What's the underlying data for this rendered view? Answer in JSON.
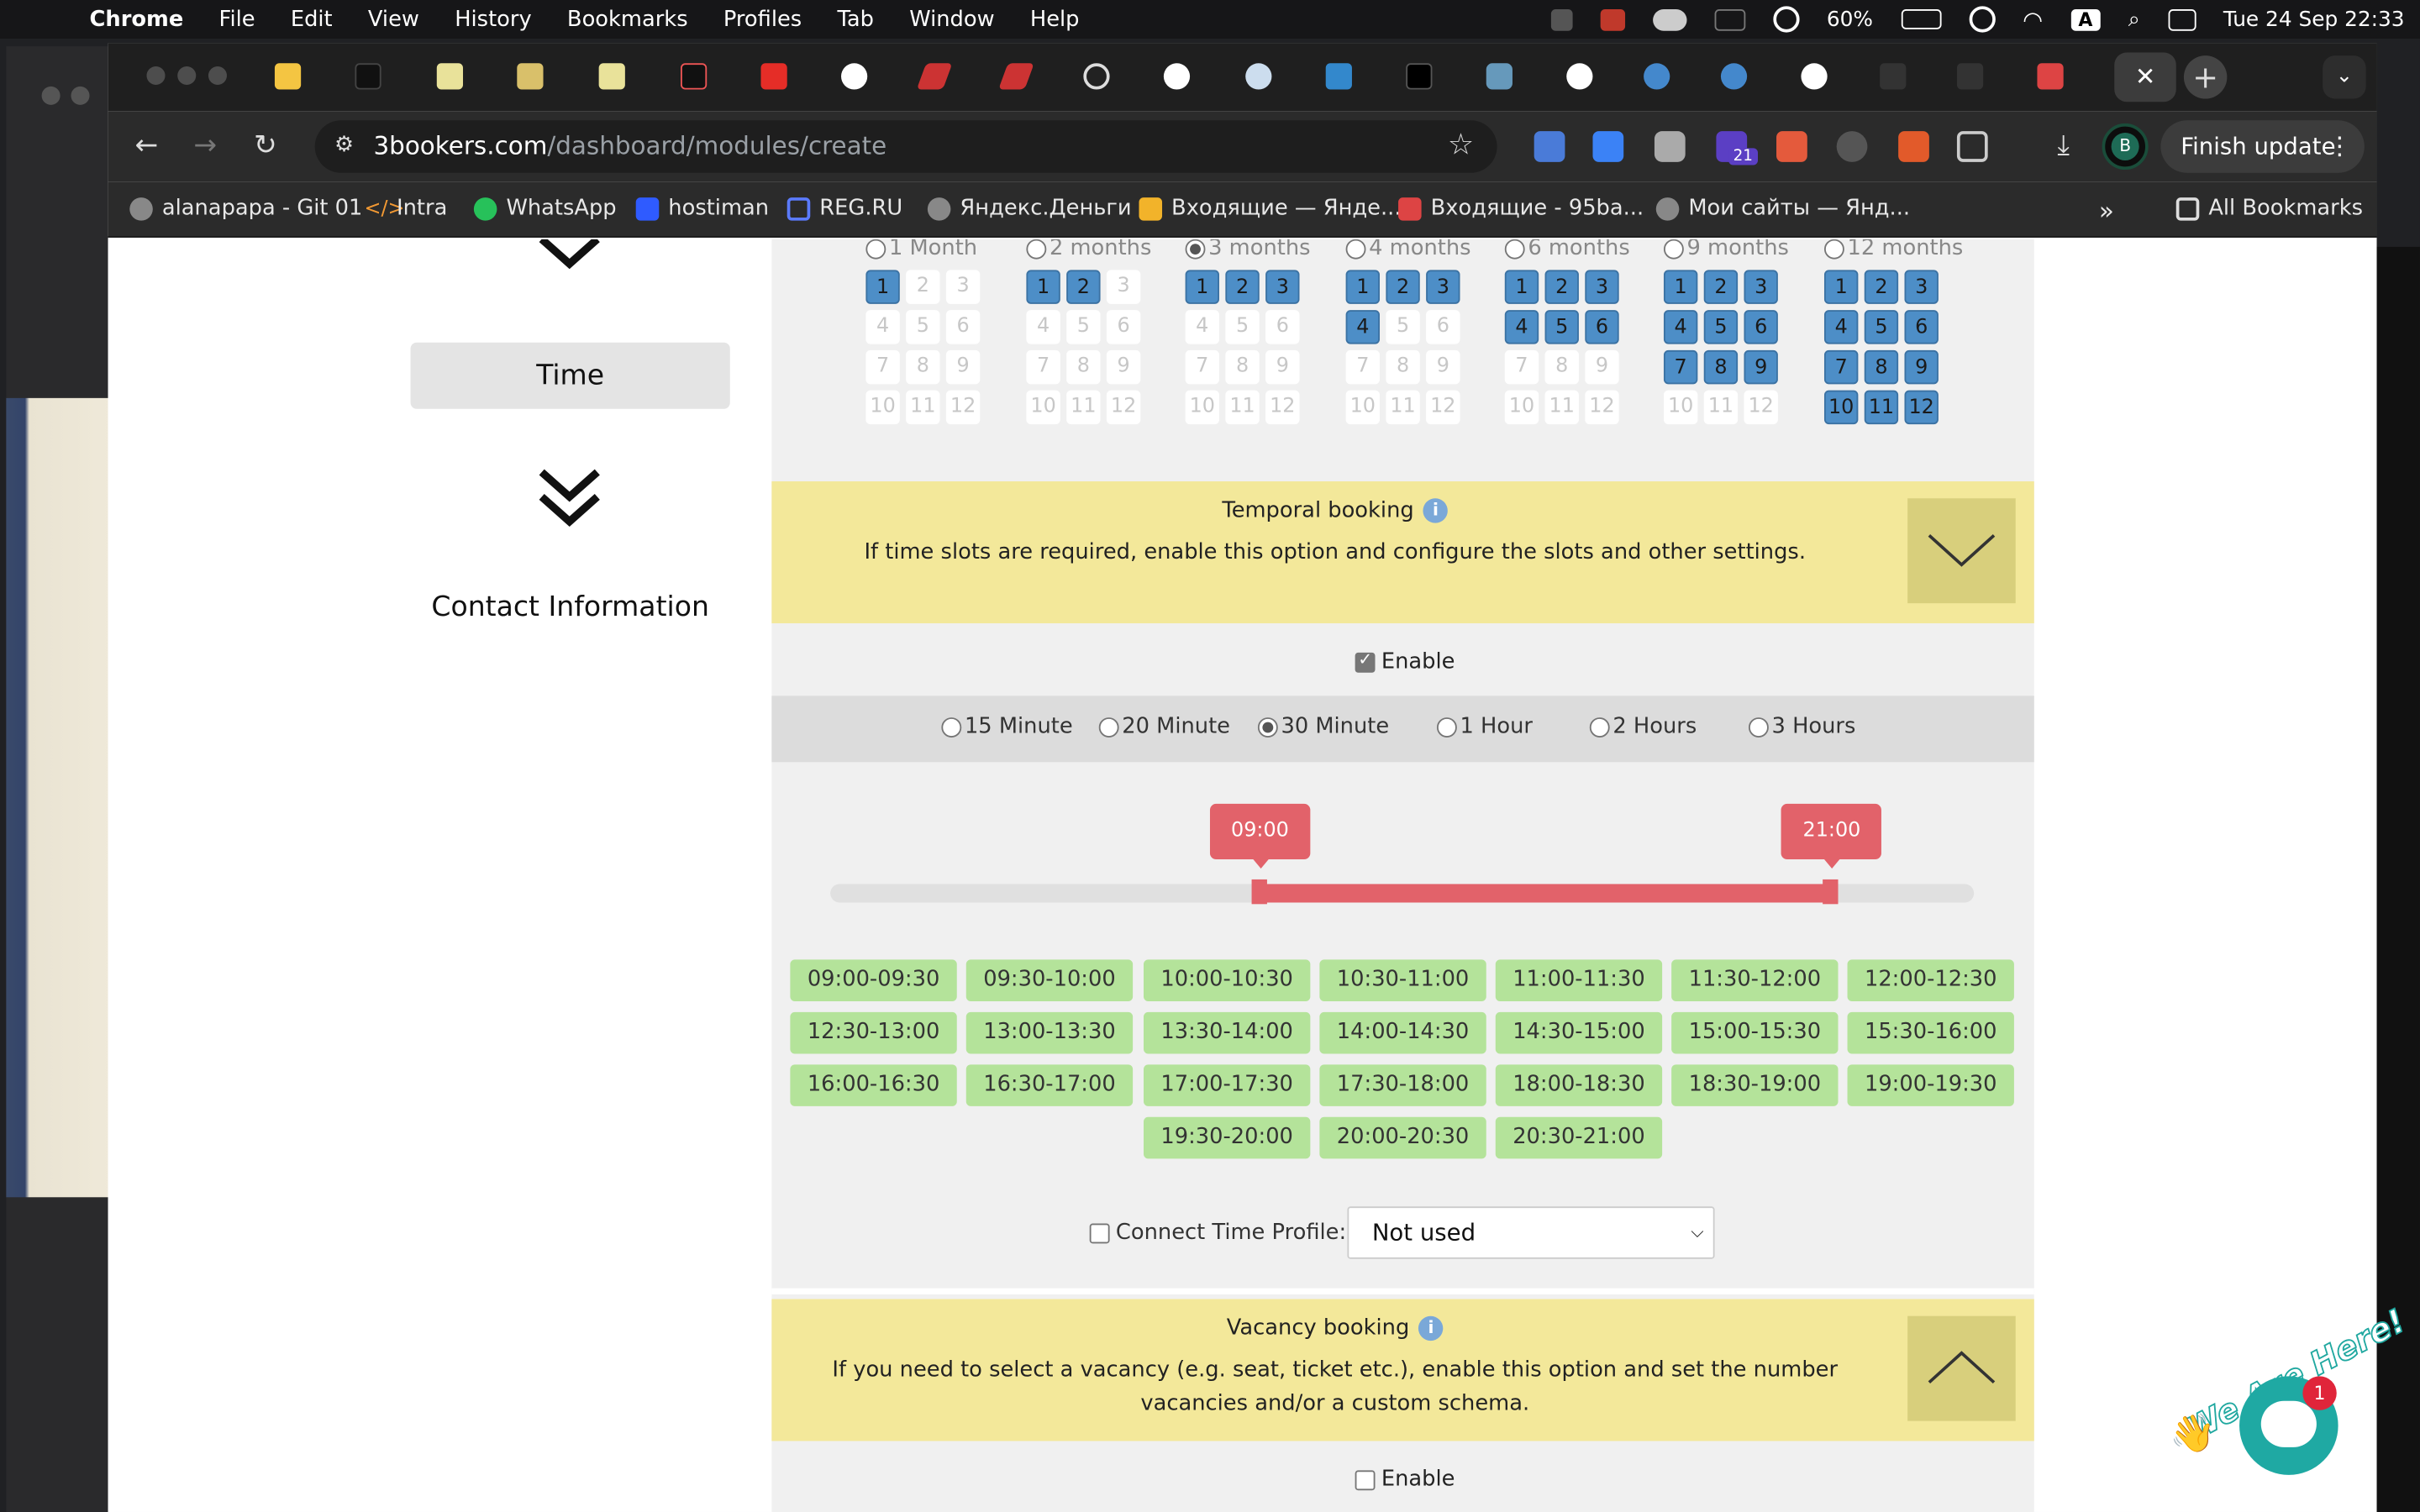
{
  "menubar": {
    "app": "Chrome",
    "items": [
      "File",
      "Edit",
      "View",
      "History",
      "Bookmarks",
      "Profiles",
      "Tab",
      "Window",
      "Help"
    ],
    "battery": "60%",
    "input_source": "A",
    "datetime": "Tue 24 Sep  22:33"
  },
  "browser": {
    "close_tab": "✕",
    "new_tab": "+",
    "url_host": "3bookers.com",
    "url_path": "/dashboard/modules/create",
    "ext_badge": "21",
    "avatar_letter": "B",
    "finish_update": "Finish update",
    "bookmarks": [
      "alanapapa - Git 01",
      "Intra",
      "WhatsApp",
      "hostiman",
      "REG.RU",
      "Яндекс.Деньги",
      "Входящие — Янде...",
      "Входящие - 95ba...",
      "Мои сайты — Янд..."
    ],
    "all_bookmarks": "All Bookmarks",
    "bookmarks_overflow": "»"
  },
  "sidebar": {
    "time_button": "Time",
    "contact_info": "Contact Information"
  },
  "months": [
    {
      "label": "1 Month",
      "selected": false,
      "active": [
        1
      ]
    },
    {
      "label": "2 months",
      "selected": false,
      "active": [
        1,
        2
      ]
    },
    {
      "label": "3 months",
      "selected": true,
      "active": [
        1,
        2,
        3
      ]
    },
    {
      "label": "4 months",
      "selected": false,
      "active": [
        1,
        2,
        3,
        4
      ]
    },
    {
      "label": "6 months",
      "selected": false,
      "active": [
        1,
        2,
        3,
        4,
        5,
        6
      ]
    },
    {
      "label": "9 months",
      "selected": false,
      "active": [
        1,
        2,
        3,
        4,
        5,
        6,
        7,
        8,
        9
      ]
    },
    {
      "label": "12 months",
      "selected": false,
      "active": [
        1,
        2,
        3,
        4,
        5,
        6,
        7,
        8,
        9,
        10,
        11,
        12
      ]
    }
  ],
  "temporal": {
    "title": "Temporal booking",
    "info_icon": "i",
    "desc": "If time slots are required, enable this option and configure the slots and other settings.",
    "enable_label": "Enable",
    "enabled": true
  },
  "durations": [
    {
      "label": "15 Minute",
      "selected": false
    },
    {
      "label": "20 Minute",
      "selected": false
    },
    {
      "label": "30 Minute",
      "selected": true
    },
    {
      "label": "1 Hour",
      "selected": false
    },
    {
      "label": "2 Hours",
      "selected": false
    },
    {
      "label": "3 Hours",
      "selected": false
    }
  ],
  "range": {
    "start": "09:00",
    "end": "21:00",
    "min_hour": 0,
    "max_hour": 24
  },
  "slots": [
    "09:00-09:30",
    "09:30-10:00",
    "10:00-10:30",
    "10:30-11:00",
    "11:00-11:30",
    "11:30-12:00",
    "12:00-12:30",
    "12:30-13:00",
    "13:00-13:30",
    "13:30-14:00",
    "14:00-14:30",
    "14:30-15:00",
    "15:00-15:30",
    "15:30-16:00",
    "16:00-16:30",
    "16:30-17:00",
    "17:00-17:30",
    "17:30-18:00",
    "18:00-18:30",
    "18:30-19:00",
    "19:00-19:30",
    "19:30-20:00",
    "20:00-20:30",
    "20:30-21:00"
  ],
  "time_profile": {
    "label": "Connect Time Profile:",
    "checked": false,
    "value": "Not used"
  },
  "vacancy": {
    "title": "Vacancy booking",
    "info_icon": "i",
    "desc": "If you need to select a vacancy (e.g. seat, ticket etc.), enable this option and set the number vacancies and/or a custom schema.",
    "enable_label": "Enable",
    "enabled": false
  },
  "chat": {
    "badge": "1",
    "tagline": "We Are Here!"
  },
  "colors": {
    "accent_blue": "#4d8ec7",
    "slot_green": "#b4e39a",
    "range_red": "#e2626a",
    "panel_yellow": "#f3e89a"
  }
}
